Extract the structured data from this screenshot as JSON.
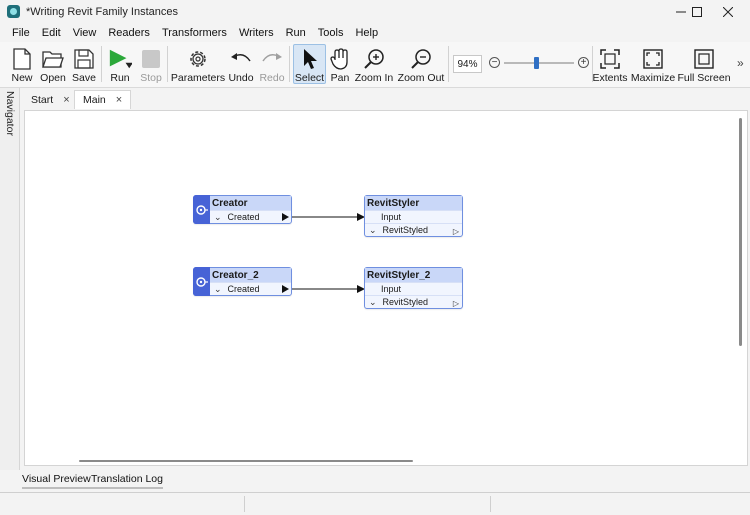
{
  "window": {
    "title": "*Writing Revit Family Instances"
  },
  "menu": {
    "items": [
      "File",
      "Edit",
      "View",
      "Readers",
      "Transformers",
      "Writers",
      "Run",
      "Tools",
      "Help"
    ]
  },
  "toolbar": {
    "new": "New",
    "open": "Open",
    "save": "Save",
    "run": "Run",
    "stop": "Stop",
    "parameters": "Parameters",
    "undo": "Undo",
    "redo": "Redo",
    "select": "Select",
    "pan": "Pan",
    "zoom_in": "Zoom In",
    "zoom_out": "Zoom Out",
    "zoom_level": "94%",
    "zoom_slider_fraction": 0.45,
    "extents": "Extents",
    "maximize": "Maximize",
    "full_screen": "Full Screen",
    "overflow": "»"
  },
  "navigator": {
    "label": "Navigator"
  },
  "tabs": [
    {
      "label": "Start",
      "close": "×"
    },
    {
      "label": "Main",
      "close": "×"
    }
  ],
  "canvas": {
    "nodes": {
      "creator_1": {
        "title": "Creator",
        "port": "Created"
      },
      "styler_1": {
        "title": "RevitStyler",
        "input": "Input",
        "output": "RevitStyled"
      },
      "creator_2": {
        "title": "Creator_2",
        "port": "Created"
      },
      "styler_2": {
        "title": "RevitStyler_2",
        "input": "Input",
        "output": "RevitStyled"
      }
    }
  },
  "bottom_tabs": {
    "visual_preview": "Visual Preview",
    "translation_log": "Translation Log"
  },
  "colors": {
    "creator_accent": "#4763d6",
    "node_header": "#c9d7f8",
    "node_border": "#6f8fe0",
    "run_green": "#2ba83a",
    "select_active": "#d8e6f5",
    "zoom_thumb": "#2f6fc4"
  }
}
